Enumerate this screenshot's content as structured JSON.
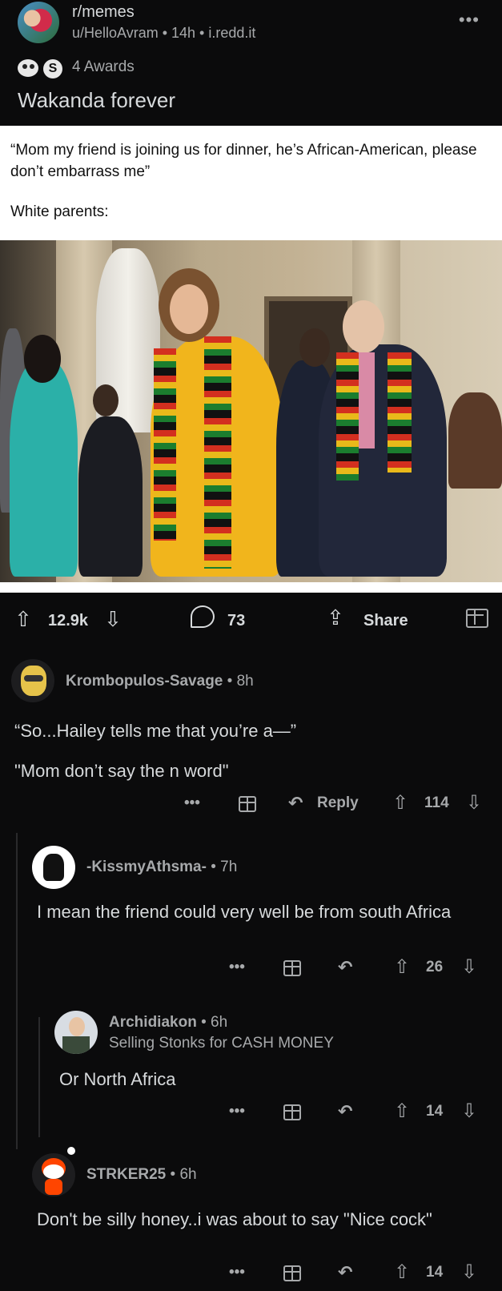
{
  "post": {
    "subreddit": "r/memes",
    "meta": "u/HelloAvram • 14h • i.redd.it",
    "awards_count_label": "4 Awards",
    "award_badge_letter": "S",
    "title": "Wakanda forever",
    "more_glyph": "•••"
  },
  "meme": {
    "caption_line": "“Mom my friend is joining us for dinner, he’s African-American, please don’t embarrass me”",
    "caption_punchline": "White parents:"
  },
  "actions": {
    "upvotes": "12.9k",
    "comments": "73",
    "share_label": "Share"
  },
  "comments": [
    {
      "user": "Krombopulos-Savage",
      "age": "• 8h",
      "paragraphs": [
        "“So...Hailey tells me that you’re a—”",
        "\"Mom don’t say the n word\""
      ],
      "reply_label": "Reply",
      "score": "114"
    },
    {
      "user": "-KissmyAthsma-",
      "age": "• 7h",
      "text": "I mean the friend could very well be from south Africa",
      "score": "26"
    },
    {
      "user": "Archidiakon",
      "age": "• 6h",
      "flair": "Selling Stonks for CASH MONEY",
      "text": "Or North Africa",
      "score": "14"
    },
    {
      "user": "STRKER25",
      "age": "• 6h",
      "text": "Don't be silly honey..i was about to say \"Nice cock\"",
      "score": "14"
    }
  ],
  "icons": {
    "upvote": "⇧",
    "downvote": "⇩",
    "reply": "↶",
    "more": "•••"
  },
  "colors": {
    "background": "#0b0b0c",
    "text_primary": "#d7dadc",
    "text_secondary": "#a7a9ab"
  }
}
